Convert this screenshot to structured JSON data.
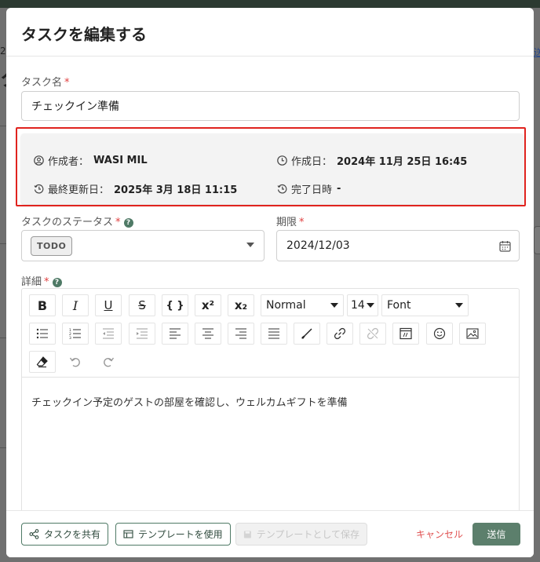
{
  "modal": {
    "title": "タスクを編集する"
  },
  "task_name": {
    "label": "タスク名",
    "required_mark": "*",
    "value": "チェックイン準備"
  },
  "info": {
    "creator_label": "作成者：",
    "creator_value": "WASI MIL",
    "created_label": "作成日：",
    "created_value": "2024年 11月 25日 16:45",
    "updated_label": "最終更新日：",
    "updated_value": "2025年 3月 18日 11:15",
    "completed_label": "完了日時",
    "completed_value": "-"
  },
  "status": {
    "label": "タスクのステータス",
    "required_mark": "*",
    "help": "?",
    "value": "TODO"
  },
  "deadline": {
    "label": "期限",
    "required_mark": "*",
    "value": "2024/12/03"
  },
  "details": {
    "label": "詳細",
    "required_mark": "*",
    "help": "?",
    "content": "チェックイン予定のゲストの部屋を確認し、ウェルカムギフトを準備"
  },
  "toolbar": {
    "bold": "B",
    "italic": "I",
    "underline": "U",
    "strike": "S",
    "code": "{ }",
    "superscript": "x²",
    "subscript": "x₂",
    "heading_value": "Normal",
    "size_value": "14",
    "font_value": "Font"
  },
  "footer": {
    "share_label": "タスクを共有",
    "use_template_label": "テンプレートを使用",
    "save_template_label": "テンプレートとして保存",
    "cancel_label": "キャンセル",
    "send_label": "送信"
  },
  "background": {
    "right_text": "送"
  },
  "colors": {
    "accent": "#5c7f6c",
    "highlight": "#e0231e",
    "required": "#e04040",
    "cancel": "#e05050"
  }
}
